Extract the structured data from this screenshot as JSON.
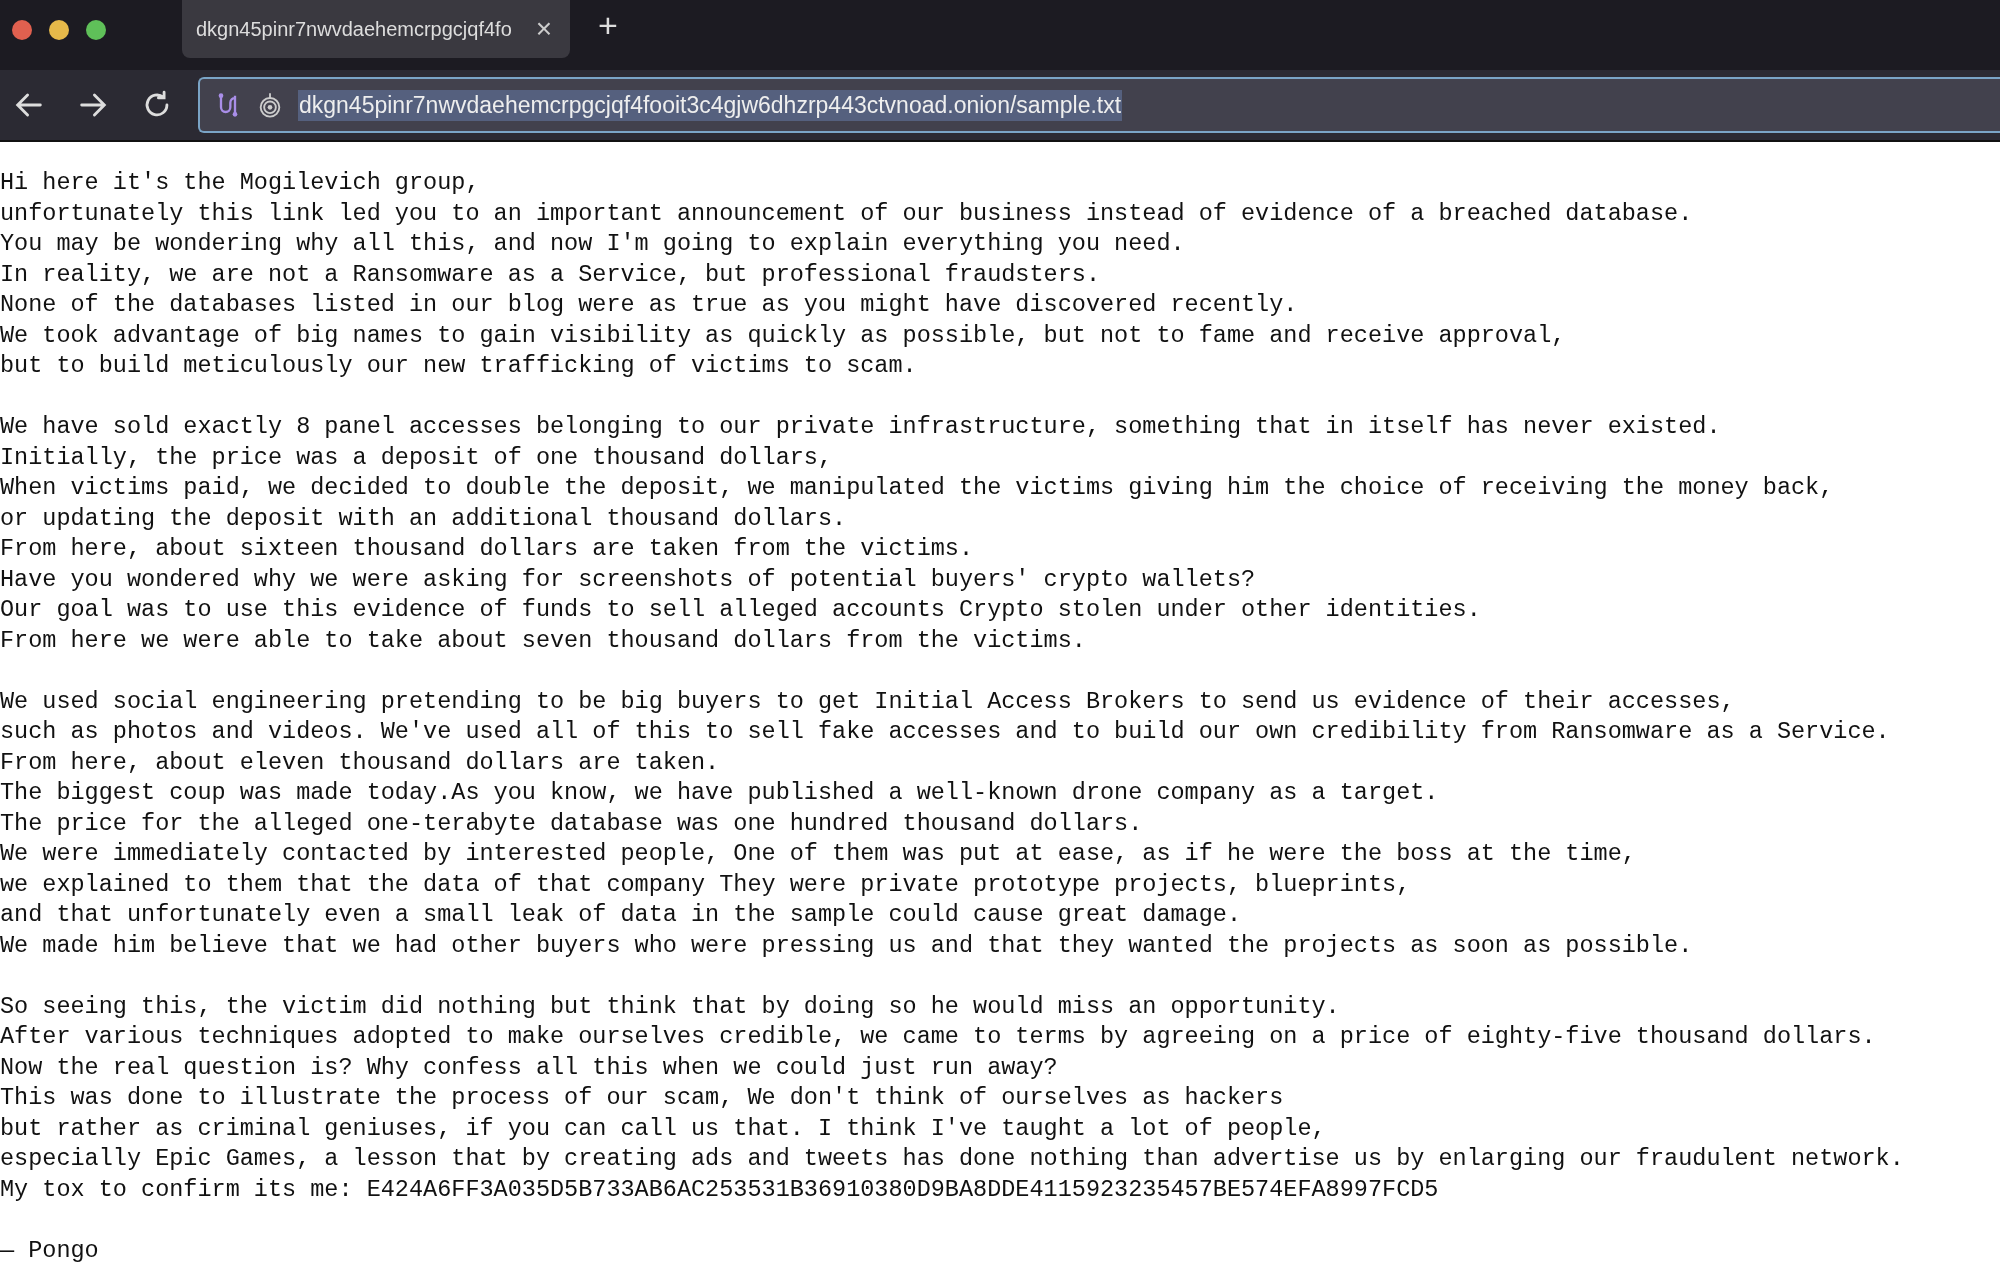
{
  "tabs": [
    {
      "title": "dkgn45pinr7nwvdaehemcrpgcjqf4fo",
      "close": "×",
      "selected": true
    }
  ],
  "new_tab": "+",
  "address_bar": {
    "value": "dkgn45pinr7nwvdaehemcrpgcjqf4fooit3c4gjw6dhzrp443ctvnoad.onion/sample.txt",
    "text_selected": true
  },
  "document": {
    "paragraphs": [
      [
        "Hi here it's the Mogilevich group,",
        "unfortunately this link led you to an important announcement of our business instead of evidence of a breached database.",
        "You may be wondering why all this, and now I'm going to explain everything you need.",
        "In reality, we are not a Ransomware as a Service, but professional fraudsters.",
        "None of the databases listed in our blog were as true as you might have discovered recently.",
        "We took advantage of big names to gain visibility as quickly as possible, but not to fame and receive approval,",
        "but to build meticulously our new trafficking of victims to scam."
      ],
      [
        "We have sold exactly 8 panel accesses belonging to our private infrastructure, something that in itself has never existed.",
        "Initially, the price was a deposit of one thousand dollars,",
        "When victims paid, we decided to double the deposit, we manipulated the victims giving him the choice of receiving the money back,",
        "or updating the deposit with an additional thousand dollars.",
        "From here, about sixteen thousand dollars are taken from the victims.",
        "Have you wondered why we were asking for screenshots of potential buyers' crypto wallets?",
        "Our goal was to use this evidence of funds to sell alleged accounts Crypto stolen under other identities.",
        "From here we were able to take about seven thousand dollars from the victims."
      ],
      [
        "We used social engineering pretending to be big buyers to get Initial Access Brokers to send us evidence of their accesses,",
        "such as photos and videos. We've used all of this to sell fake accesses and to build our own credibility from Ransomware as a Service.",
        "From here, about eleven thousand dollars are taken.",
        "The biggest coup was made today.As you know, we have published a well-known drone company as a target.",
        "The price for the alleged one-terabyte database was one hundred thousand dollars.",
        "We were immediately contacted by interested people, One of them was put at ease, as if he were the boss at the time,",
        "we explained to them that the data of that company They were private prototype projects, blueprints,",
        "and that unfortunately even a small leak of data in the sample could cause great damage.",
        "We made him believe that we had other buyers who were pressing us and that they wanted the projects as soon as possible."
      ],
      [
        "So seeing this, the victim did nothing but think that by doing so he would miss an opportunity.",
        "After various techniques adopted to make ourselves credible, we came to terms by agreeing on a price of eighty-five thousand dollars.",
        "Now the real question is? Why confess all this when we could just run away?",
        "This was done to illustrate the process of our scam, We don't think of ourselves as hackers",
        "but rather as criminal geniuses, if you can call us that. I think I've taught a lot of people,",
        "especially Epic Games, a lesson that by creating ads and tweets has done nothing than advertise us by enlarging our fraudulent network.",
        "My tox to confirm its me: E424A6FF3A035D5B733AB6AC253531B36910380D9BA8DDE4115923235457BE574EFA8997FCD5"
      ],
      [
        "— Pongo"
      ]
    ]
  }
}
